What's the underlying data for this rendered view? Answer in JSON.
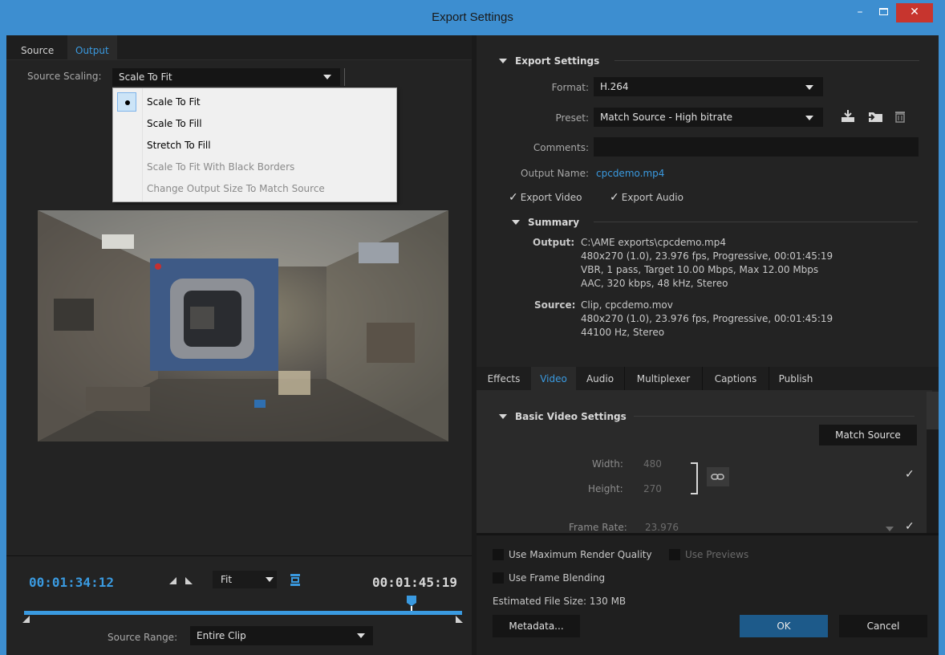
{
  "window": {
    "title": "Export Settings",
    "minimize_label": "–",
    "close_label": "✕"
  },
  "left": {
    "tabs": [
      {
        "label": "Source"
      },
      {
        "label": "Output"
      }
    ],
    "source_scaling": {
      "label": "Source Scaling:",
      "value": "Scale To Fit"
    },
    "dropdown_options": [
      {
        "label": "Scale To Fit",
        "selected": true,
        "enabled": true
      },
      {
        "label": "Scale To Fill",
        "selected": false,
        "enabled": true
      },
      {
        "label": "Stretch To Fill",
        "selected": false,
        "enabled": true
      },
      {
        "label": "Scale To Fit With Black Borders",
        "selected": false,
        "enabled": false
      },
      {
        "label": "Change Output Size To Match Source",
        "selected": false,
        "enabled": false
      }
    ],
    "timeline": {
      "current_time": "00:01:34:12",
      "duration": "00:01:45:19",
      "zoom": "Fit",
      "playhead_fraction": 0.895
    },
    "source_range": {
      "label": "Source Range:",
      "value": "Entire Clip"
    }
  },
  "export_settings": {
    "section_title": "Export Settings",
    "format_label": "Format:",
    "format_value": "H.264",
    "preset_label": "Preset:",
    "preset_value": "Match Source - High bitrate",
    "comments_label": "Comments:",
    "comments_value": "",
    "output_name_label": "Output Name:",
    "output_name_value": "cpcdemo.mp4",
    "export_video_label": "Export Video",
    "export_audio_label": "Export Audio",
    "summary_title": "Summary",
    "output_key": "Output:",
    "output_lines": [
      "C:\\AME exports\\cpcdemo.mp4",
      "480x270 (1.0), 23.976 fps, Progressive, 00:01:45:19",
      "VBR, 1 pass, Target 10.00 Mbps, Max 12.00 Mbps",
      "AAC, 320 kbps, 48 kHz, Stereo"
    ],
    "source_key": "Source:",
    "source_lines": [
      "Clip, cpcdemo.mov",
      "480x270 (1.0), 23.976 fps, Progressive, 00:01:45:19",
      "44100 Hz, Stereo"
    ]
  },
  "right_tabs": [
    {
      "label": "Effects"
    },
    {
      "label": "Video"
    },
    {
      "label": "Audio"
    },
    {
      "label": "Multiplexer"
    },
    {
      "label": "Captions"
    },
    {
      "label": "Publish"
    }
  ],
  "video": {
    "section_title": "Basic Video Settings",
    "match_source_label": "Match Source",
    "width_label": "Width:",
    "width_value": "480",
    "height_label": "Height:",
    "height_value": "270",
    "frame_rate_label": "Frame Rate:",
    "frame_rate_value": "23.976"
  },
  "bottom": {
    "max_render_label": "Use Maximum Render Quality",
    "use_previews_label": "Use Previews",
    "frame_blending_label": "Use Frame Blending",
    "file_size_label": "Estimated File Size:",
    "file_size_value": "130 MB",
    "metadata_label": "Metadata...",
    "ok_label": "OK",
    "cancel_label": "Cancel"
  },
  "colors": {
    "accent": "#3a9ae0",
    "title_bar": "#3d8ed0",
    "close_button": "#c7352e",
    "panel": "#232323"
  }
}
